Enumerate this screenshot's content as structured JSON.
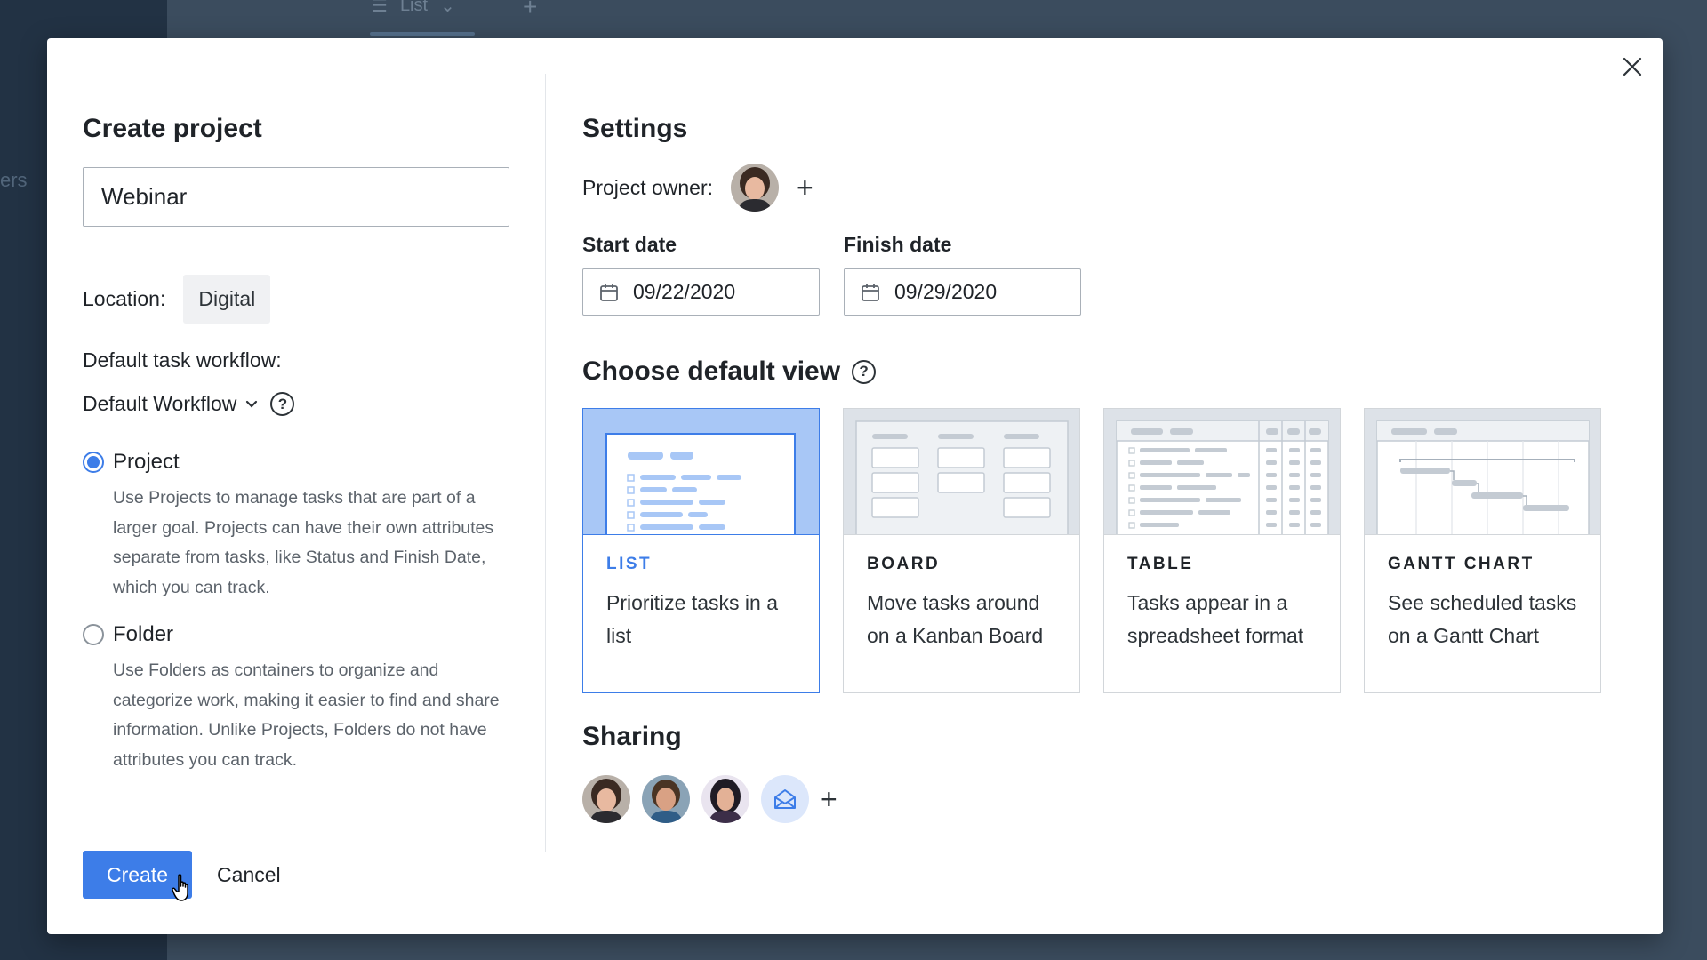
{
  "background": {
    "sidebar_partial_text": "ers",
    "tab_label": "List"
  },
  "modal": {
    "title": "Create project",
    "name_value": "Webinar",
    "location_label": "Location:",
    "location_value": "Digital",
    "workflow_label": "Default task workflow:",
    "workflow_value": "Default Workflow",
    "types": [
      {
        "label": "Project",
        "checked": true,
        "description": "Use Projects to manage tasks that are part of a larger goal. Projects can have their own attributes separate from tasks, like Status and Finish Date, which you can track."
      },
      {
        "label": "Folder",
        "checked": false,
        "description": "Use Folders as containers to organize and categorize work, making it easier to find and share information. Unlike Projects, Folders do not have attributes you can track."
      }
    ],
    "create_label": "Create",
    "cancel_label": "Cancel",
    "settings": {
      "title": "Settings",
      "owner_label": "Project owner:",
      "start_label": "Start date",
      "start_value": "09/22/2020",
      "finish_label": "Finish date",
      "finish_value": "09/29/2020",
      "view_title": "Choose default view",
      "views": [
        {
          "name": "LIST",
          "desc": "Prioritize tasks in a list",
          "selected": true
        },
        {
          "name": "BOARD",
          "desc": "Move tasks around on a Kanban Board",
          "selected": false
        },
        {
          "name": "TABLE",
          "desc": "Tasks appear in a spreadsheet format",
          "selected": false
        },
        {
          "name": "GANTT CHART",
          "desc": "See scheduled tasks on a Gantt Chart",
          "selected": false
        }
      ],
      "sharing_title": "Sharing"
    }
  },
  "colors": {
    "accent": "#3d7de8",
    "backdrop": "#3b4c5e",
    "selected_thumb": "#a8c7f6"
  },
  "icons": [
    "close-icon",
    "calendar-icon",
    "chevron-down-icon",
    "help-icon",
    "plus-icon",
    "mail-icon",
    "hand-cursor-icon"
  ]
}
